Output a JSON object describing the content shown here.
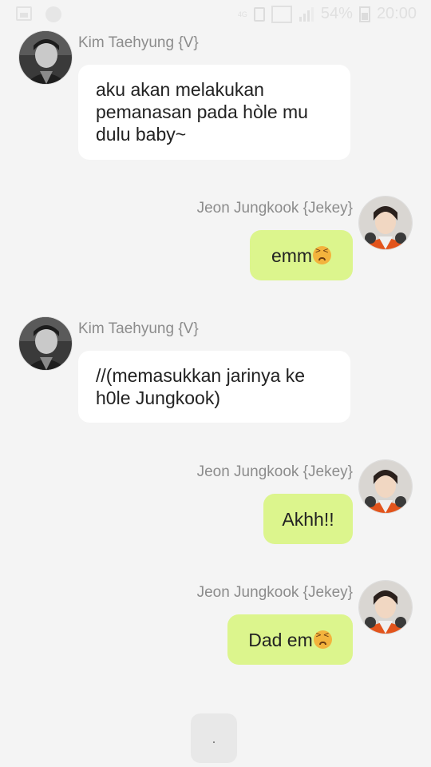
{
  "status_bar": {
    "network_label": "4G",
    "battery_percent": "54%",
    "time": "20:00"
  },
  "messages": [
    {
      "sender": "Kim Taehyung {V}",
      "side": "left",
      "text": "aku akan melakukan pemanasan pada hòle mu dulu baby~"
    },
    {
      "sender": "Jeon Jungkook {Jekey}",
      "side": "right",
      "text": "emm",
      "emoji": "tired-face-emoji"
    },
    {
      "sender": "Kim Taehyung {V}",
      "side": "left",
      "text": "//(memasukkan jarinya ke h0le Jungkook)"
    },
    {
      "sender": "Jeon Jungkook {Jekey}",
      "side": "right",
      "text": "Akhh!!"
    },
    {
      "sender": "Jeon Jungkook {Jekey}",
      "side": "right",
      "text": "Dad em",
      "emoji": "tired-face-emoji"
    }
  ],
  "typing_indicator": "."
}
